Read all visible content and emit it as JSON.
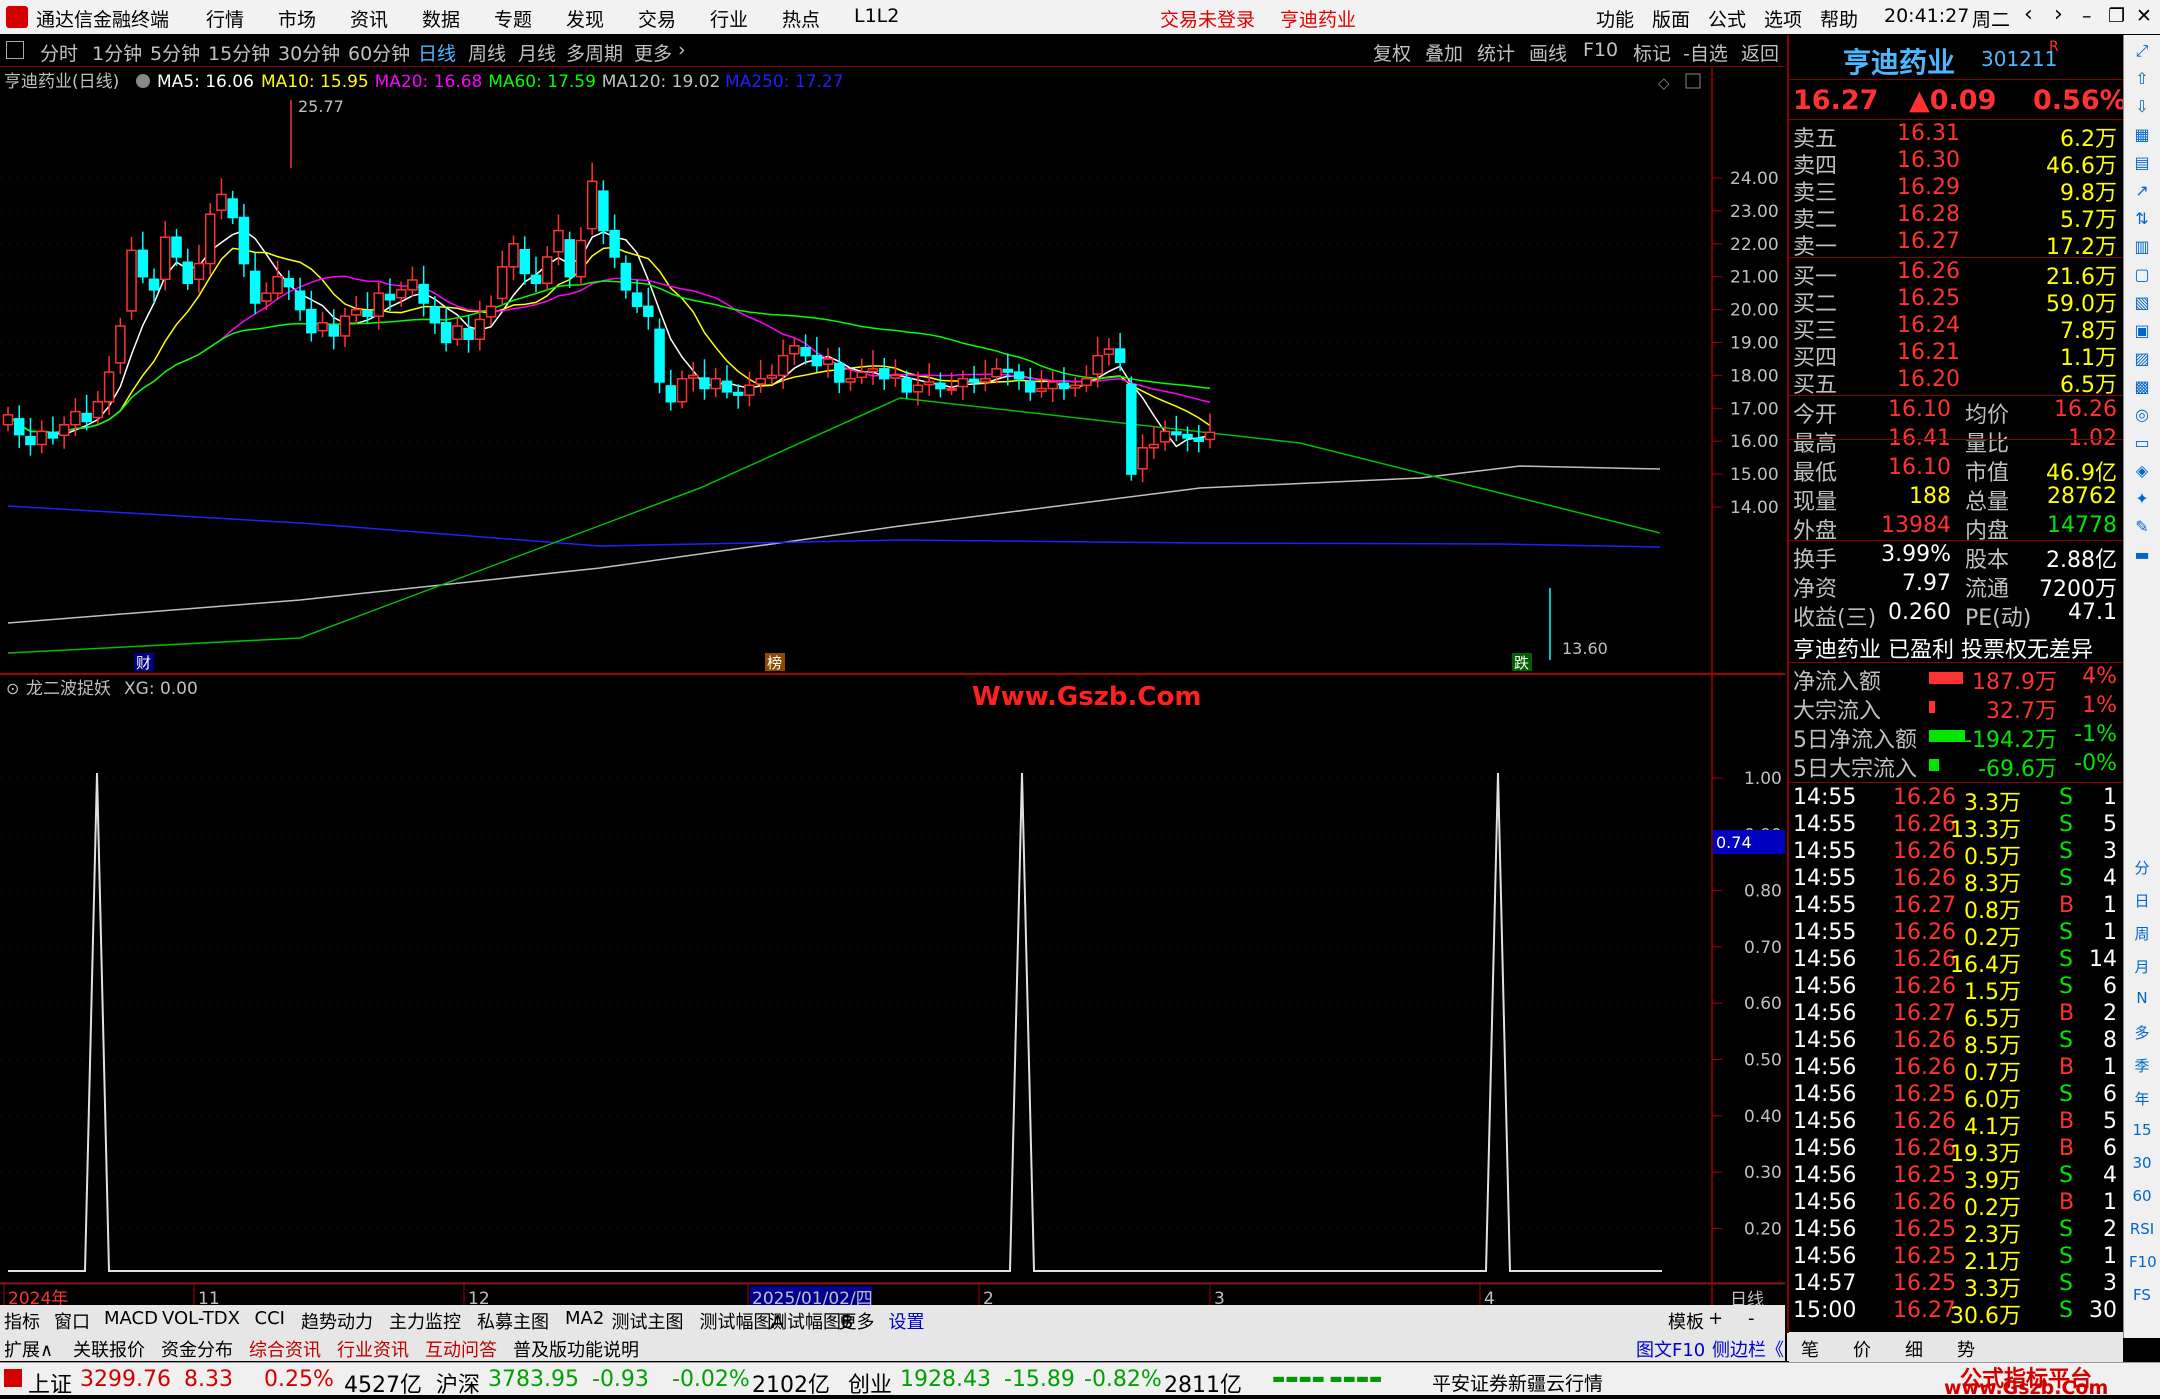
{
  "app": {
    "title": "通达信金融终端",
    "menus": [
      "行情",
      "市场",
      "资讯",
      "数据",
      "专题",
      "发现",
      "交易",
      "行业",
      "热点",
      "L1L2"
    ],
    "status_red": "交易未登录",
    "stock_red": "亨迪药业",
    "right_menus": [
      "功能",
      "版面",
      "公式",
      "选项",
      "帮助"
    ],
    "time": "20:41:27",
    "weekday": "周二"
  },
  "periods": {
    "items": [
      "分时",
      "1分钟",
      "5分钟",
      "15分钟",
      "30分钟",
      "60分钟",
      "日线",
      "周线",
      "月线",
      "多周期",
      "更多"
    ],
    "active": "日线",
    "tools": [
      "复权",
      "叠加",
      "统计",
      "画线",
      "F10",
      "标记",
      "-自选",
      "返回"
    ]
  },
  "main_chart": {
    "name": "亨迪药业(日线)",
    "ma": [
      {
        "label": "MA5: 16.06",
        "color": "#ffffff"
      },
      {
        "label": "MA10: 15.95",
        "color": "#ffff00"
      },
      {
        "label": "MA20: 16.68",
        "color": "#ff00ff"
      },
      {
        "label": "MA60: 17.59",
        "color": "#00ff00"
      },
      {
        "label": "MA120: 19.02",
        "color": "#c0c0c0"
      },
      {
        "label": "MA250: 17.27",
        "color": "#2020ff"
      }
    ],
    "yticks": [
      "24.00",
      "23.00",
      "22.00",
      "21.00",
      "20.00",
      "19.00",
      "18.00",
      "17.00",
      "16.00",
      "15.00",
      "14.00"
    ],
    "high_label": "25.77",
    "low_label": "13.60",
    "markers": [
      "财",
      "榜",
      "跌"
    ]
  },
  "indicator": {
    "name": "龙二波捉妖",
    "value": "XG: 0.00",
    "watermark": "Www.Gszb.Com",
    "yticks": [
      "1.00",
      "0.90",
      "0.80",
      "0.70",
      "0.60",
      "0.50",
      "0.40",
      "0.30",
      "0.20"
    ],
    "cursor_value": "0.74"
  },
  "xaxis": {
    "labels": [
      "2024年",
      "11",
      "12",
      "2025/01/02/四",
      "2",
      "3",
      "4"
    ],
    "period": "日线"
  },
  "chart_data": {
    "type": "candlestick",
    "y_axis_range": [
      13.6,
      25.77
    ],
    "indicator_spikes_x": [
      "2024-10",
      "2025-02",
      "2025-04"
    ],
    "indicator_range": [
      0,
      1
    ]
  },
  "quote": {
    "name": "亨迪药业",
    "code": "301211",
    "flag": "R",
    "price": "16.27",
    "change": "▲0.09",
    "pct": "0.56%",
    "asks": [
      {
        "l": "卖五",
        "p": "16.31",
        "v": "6.2万"
      },
      {
        "l": "卖四",
        "p": "16.30",
        "v": "46.6万"
      },
      {
        "l": "卖三",
        "p": "16.29",
        "v": "9.8万"
      },
      {
        "l": "卖二",
        "p": "16.28",
        "v": "5.7万"
      },
      {
        "l": "卖一",
        "p": "16.27",
        "v": "17.2万"
      }
    ],
    "bids": [
      {
        "l": "买一",
        "p": "16.26",
        "v": "21.6万"
      },
      {
        "l": "买二",
        "p": "16.25",
        "v": "59.0万"
      },
      {
        "l": "买三",
        "p": "16.24",
        "v": "7.8万"
      },
      {
        "l": "买四",
        "p": "16.21",
        "v": "1.1万"
      },
      {
        "l": "买五",
        "p": "16.20",
        "v": "6.5万"
      }
    ],
    "stats": [
      [
        "今开",
        "16.10",
        "均价",
        "16.26"
      ],
      [
        "最高",
        "16.41",
        "量比",
        "1.02"
      ],
      [
        "最低",
        "16.10",
        "市值",
        "46.9亿"
      ],
      [
        "现量",
        "188",
        "总量",
        "28762"
      ],
      [
        "外盘",
        "13984",
        "内盘",
        "14778"
      ]
    ],
    "stats2": [
      [
        "换手",
        "3.99%",
        "股本",
        "2.88亿"
      ],
      [
        "净资",
        "7.97",
        "流通",
        "7200万"
      ],
      [
        "收益(三)",
        "0.260",
        "PE(动)",
        "47.1"
      ]
    ],
    "info": "亨迪药业 已盈利 投票权无差异",
    "flows": [
      {
        "l": "净流入额",
        "v": "187.9万",
        "p": "4%",
        "c": "red"
      },
      {
        "l": "大宗流入",
        "v": "32.7万",
        "p": "1%",
        "c": "red"
      },
      {
        "l": "5日净流入额",
        "v": "-194.2万",
        "p": "-1%",
        "c": "grn"
      },
      {
        "l": "5日大宗流入",
        "v": "-69.6万",
        "p": "-0%",
        "c": "grn"
      }
    ],
    "ticks": [
      [
        "14:55",
        "16.26",
        "3.3万",
        "S",
        "1"
      ],
      [
        "14:55",
        "16.26",
        "13.3万",
        "S",
        "5"
      ],
      [
        "14:55",
        "16.26",
        "0.5万",
        "S",
        "3"
      ],
      [
        "14:55",
        "16.26",
        "8.3万",
        "S",
        "4"
      ],
      [
        "14:55",
        "16.27",
        "0.8万",
        "B",
        "1"
      ],
      [
        "14:55",
        "16.26",
        "0.2万",
        "S",
        "1"
      ],
      [
        "14:56",
        "16.26",
        "16.4万",
        "S",
        "14"
      ],
      [
        "14:56",
        "16.26",
        "1.5万",
        "S",
        "6"
      ],
      [
        "14:56",
        "16.27",
        "6.5万",
        "B",
        "2"
      ],
      [
        "14:56",
        "16.26",
        "8.5万",
        "S",
        "8"
      ],
      [
        "14:56",
        "16.26",
        "0.7万",
        "B",
        "1"
      ],
      [
        "14:56",
        "16.25",
        "6.0万",
        "S",
        "6"
      ],
      [
        "14:56",
        "16.26",
        "4.1万",
        "B",
        "5"
      ],
      [
        "14:56",
        "16.26",
        "19.3万",
        "B",
        "6"
      ],
      [
        "14:56",
        "16.25",
        "3.9万",
        "S",
        "4"
      ],
      [
        "14:56",
        "16.26",
        "0.2万",
        "B",
        "1"
      ],
      [
        "14:56",
        "16.25",
        "2.3万",
        "S",
        "2"
      ],
      [
        "14:56",
        "16.25",
        "2.1万",
        "S",
        "1"
      ],
      [
        "14:57",
        "16.25",
        "3.3万",
        "S",
        "3"
      ],
      [
        "15:00",
        "16.27",
        "30.6万",
        "S",
        "30"
      ]
    ],
    "bottom_tabs": [
      "笔",
      "价",
      "细",
      "势"
    ]
  },
  "bottom_tabs1": [
    "指标",
    "窗口",
    "MACD",
    "VOL-TDX",
    "CCI",
    "趋势动力",
    "主力监控",
    "私募主图",
    "MA2",
    "测试主图",
    "测试幅图A",
    "测试幅图B",
    "更多",
    "设置"
  ],
  "bottom_right1": [
    "模板",
    "+",
    "-"
  ],
  "bottom_tabs2": [
    "扩展∧",
    "关联报价",
    "资金分布",
    "综合资讯",
    "行业资讯",
    "互动问答",
    "普及版功能说明"
  ],
  "bottom_right2": [
    "图文F10",
    "侧边栏《"
  ],
  "status": {
    "indices": [
      {
        "n": "上证",
        "v": "3299.76",
        "c": "8.33",
        "p": "0.25%",
        "a": "4527亿"
      },
      {
        "n": "沪深",
        "v": "3783.95",
        "c": "-0.93",
        "p": "-0.02%",
        "a": "2102亿"
      },
      {
        "n": "创业",
        "v": "1928.43",
        "c": "-15.89",
        "p": "-0.82%",
        "a": "2811亿"
      }
    ],
    "broker": "平安证券新疆云行情",
    "site": "公式指标平台",
    "site_url": "www.Gszb.Com"
  },
  "side_tools": [
    "分",
    "日",
    "周",
    "月",
    "N",
    "多",
    "季",
    "年",
    "15",
    "30",
    "60",
    "RSI",
    "F10",
    "FS"
  ]
}
